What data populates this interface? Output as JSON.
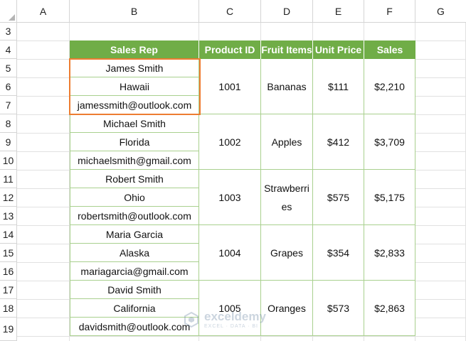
{
  "columns": [
    "A",
    "B",
    "C",
    "D",
    "E",
    "F",
    "G"
  ],
  "rows": [
    "3",
    "4",
    "5",
    "6",
    "7",
    "8",
    "9",
    "10",
    "11",
    "12",
    "13",
    "14",
    "15",
    "16",
    "17",
    "18",
    "19"
  ],
  "table": {
    "headers": [
      "Sales Rep",
      "Product ID",
      "Fruit Items",
      "Unit Price",
      "Sales"
    ],
    "records": [
      {
        "name": "James Smith",
        "state": "Hawaii",
        "email": "jamessmith@outlook.com",
        "product_id": "1001",
        "fruit": "Bananas",
        "unit_price": "$111",
        "sales": "$2,210"
      },
      {
        "name": "Michael Smith",
        "state": "Florida",
        "email": "michaelsmith@gmail.com",
        "product_id": "1002",
        "fruit": "Apples",
        "unit_price": "$412",
        "sales": "$3,709"
      },
      {
        "name": "Robert Smith",
        "state": "Ohio",
        "email": "robertsmith@outlook.com",
        "product_id": "1003",
        "fruit": "Strawberries",
        "unit_price": "$575",
        "sales": "$5,175"
      },
      {
        "name": "Maria Garcia",
        "state": "Alaska",
        "email": "mariagarcia@gmail.com",
        "product_id": "1004",
        "fruit": "Grapes",
        "unit_price": "$354",
        "sales": "$2,833"
      },
      {
        "name": "David Smith",
        "state": "California",
        "email": "davidsmith@outlook.com",
        "product_id": "1005",
        "fruit": "Oranges",
        "unit_price": "$573",
        "sales": "$2,863"
      }
    ]
  },
  "watermark": {
    "name": "exceldemy",
    "tagline": "EXCEL · DATA · BI"
  },
  "colors": {
    "header_fill": "#70ad47",
    "table_border": "#a9d08e",
    "selection": "#ed7d31"
  }
}
